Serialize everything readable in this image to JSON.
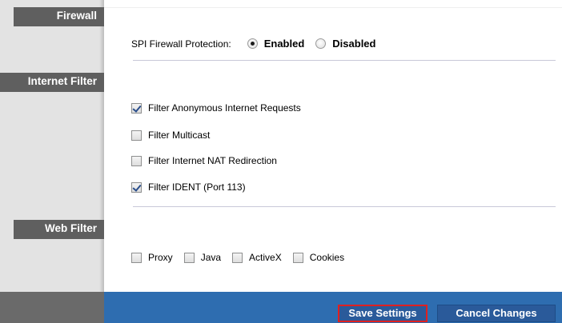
{
  "sidebar": {
    "sections": [
      "Firewall",
      "Internet Filter",
      "Web Filter"
    ]
  },
  "firewall": {
    "label": "SPI Firewall Protection:",
    "options": [
      {
        "label": "Enabled",
        "selected": true
      },
      {
        "label": "Disabled",
        "selected": false
      }
    ]
  },
  "internet_filter": {
    "items": [
      {
        "label": "Filter Anonymous Internet Requests",
        "checked": true
      },
      {
        "label": "Filter Multicast",
        "checked": false
      },
      {
        "label": "Filter Internet NAT Redirection",
        "checked": false
      },
      {
        "label": "Filter IDENT (Port 113)",
        "checked": true
      }
    ]
  },
  "web_filter": {
    "items": [
      {
        "label": "Proxy",
        "checked": false
      },
      {
        "label": "Java",
        "checked": false
      },
      {
        "label": "ActiveX",
        "checked": false
      },
      {
        "label": "Cookies",
        "checked": false
      }
    ]
  },
  "footer": {
    "save_label": "Save Settings",
    "cancel_label": "Cancel Changes"
  },
  "colors": {
    "footer_bar": "#2e6db0",
    "section_header": "#5f5f5f",
    "save_highlight": "#e02020"
  }
}
